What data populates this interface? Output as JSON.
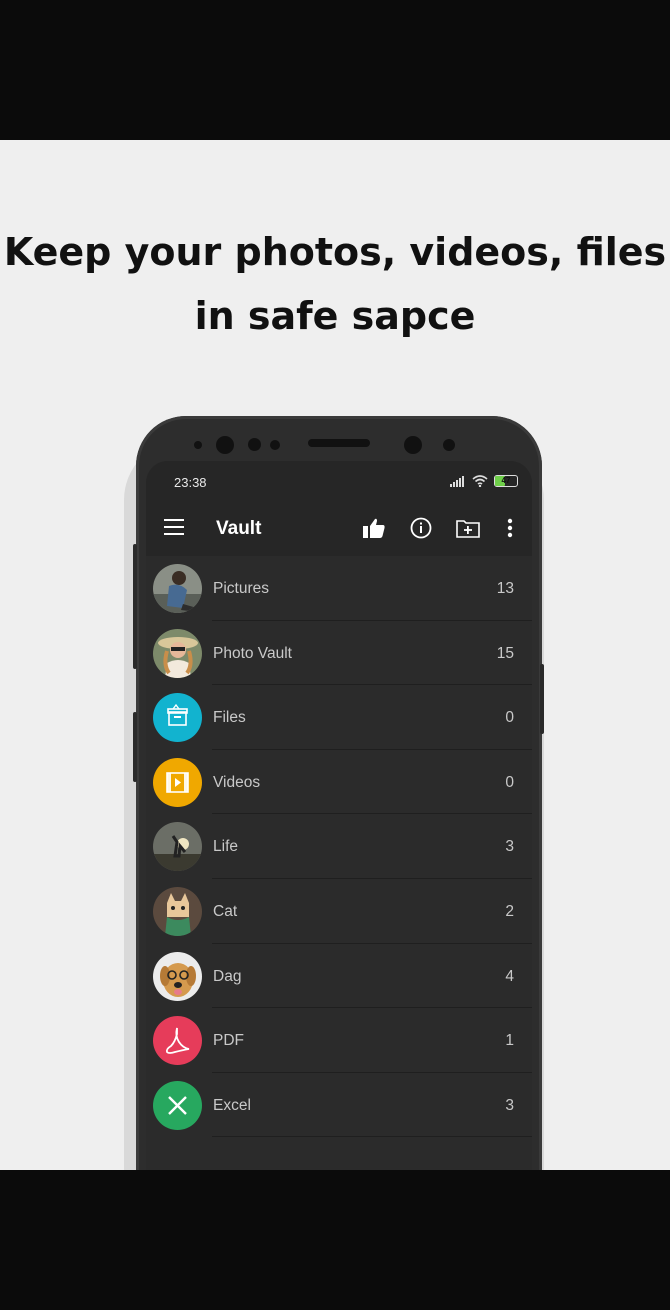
{
  "headline": {
    "line1": "Keep your photos, videos, files",
    "line2": "in safe sapce"
  },
  "status_bar": {
    "time": "23:38",
    "battery": "47"
  },
  "toolbar": {
    "title": "Vault",
    "icons": [
      "menu-icon",
      "thumbs-up-icon",
      "info-icon",
      "new-folder-icon",
      "more-vert-icon"
    ]
  },
  "folders": [
    {
      "name": "Pictures",
      "count": "13",
      "icon": "photo-thumbnail"
    },
    {
      "name": "Photo Vault",
      "count": "15",
      "icon": "photo-thumbnail"
    },
    {
      "name": "Files",
      "count": "0",
      "icon": "files-icon",
      "color": "#12b3cf"
    },
    {
      "name": "Videos",
      "count": "0",
      "icon": "videos-icon",
      "color": "#f0a800"
    },
    {
      "name": "Life",
      "count": "3",
      "icon": "photo-thumbnail"
    },
    {
      "name": "Cat",
      "count": "2",
      "icon": "photo-thumbnail"
    },
    {
      "name": "Dag",
      "count": "4",
      "icon": "photo-thumbnail"
    },
    {
      "name": "PDF",
      "count": "1",
      "icon": "pdf-icon",
      "color": "#e63c5a"
    },
    {
      "name": "Excel",
      "count": "3",
      "icon": "excel-icon",
      "color": "#27a85f"
    }
  ]
}
